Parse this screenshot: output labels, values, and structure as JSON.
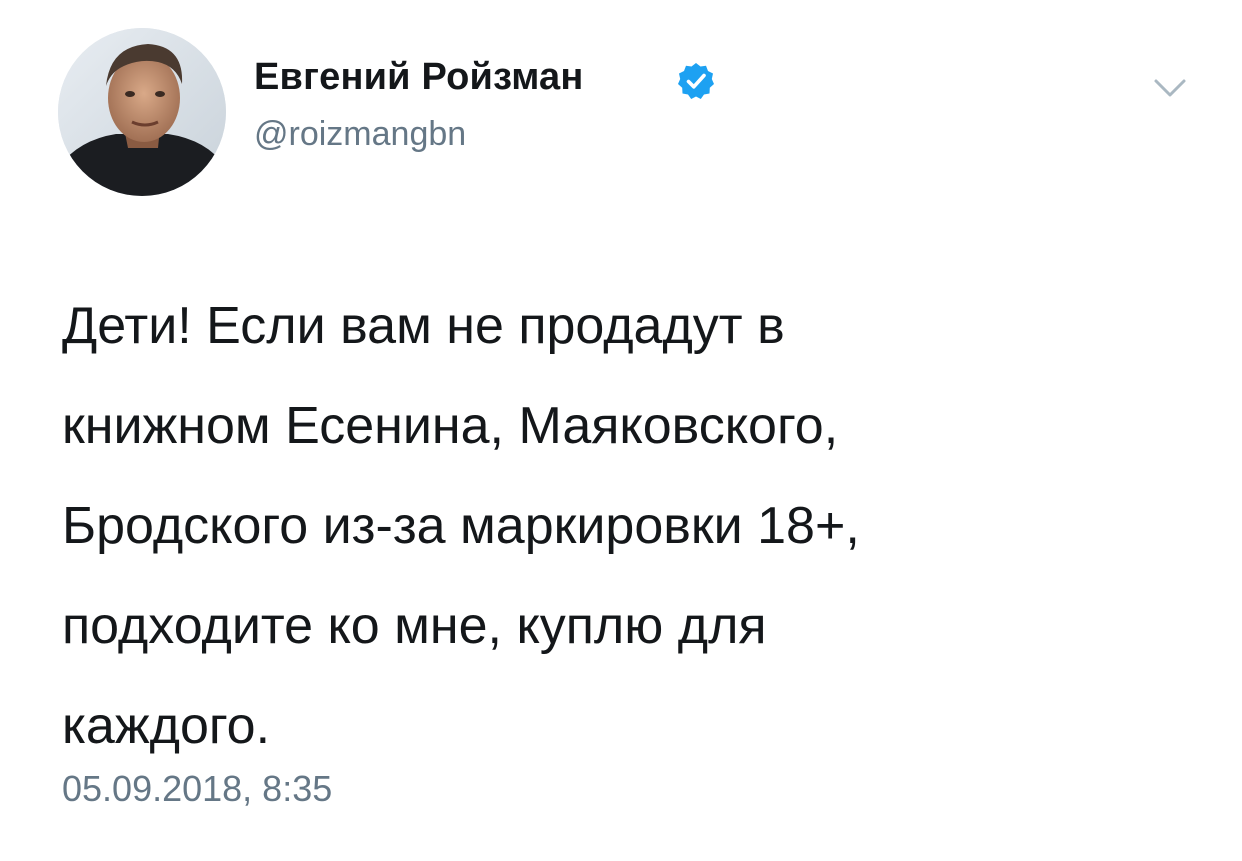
{
  "header": {
    "display_name": "Евгений Ройзман",
    "handle": "@roizmangbn",
    "verified": true,
    "avatar_icon": "user-avatar-photo",
    "menu_icon": "chevron-down-icon"
  },
  "tweet": {
    "lines": [
      "Дети! Если вам не продадут в",
      "книжном Есенина, Маяковского,",
      "Бродского из-за маркировки 18+,",
      "подходите ко мне, куплю для",
      "каждого."
    ],
    "timestamp": "05.09.2018, 8:35"
  },
  "colors": {
    "text": "#14171a",
    "secondary": "#657786",
    "verified_blue": "#1da1f2",
    "caret": "#aab8c2",
    "background": "#ffffff"
  }
}
